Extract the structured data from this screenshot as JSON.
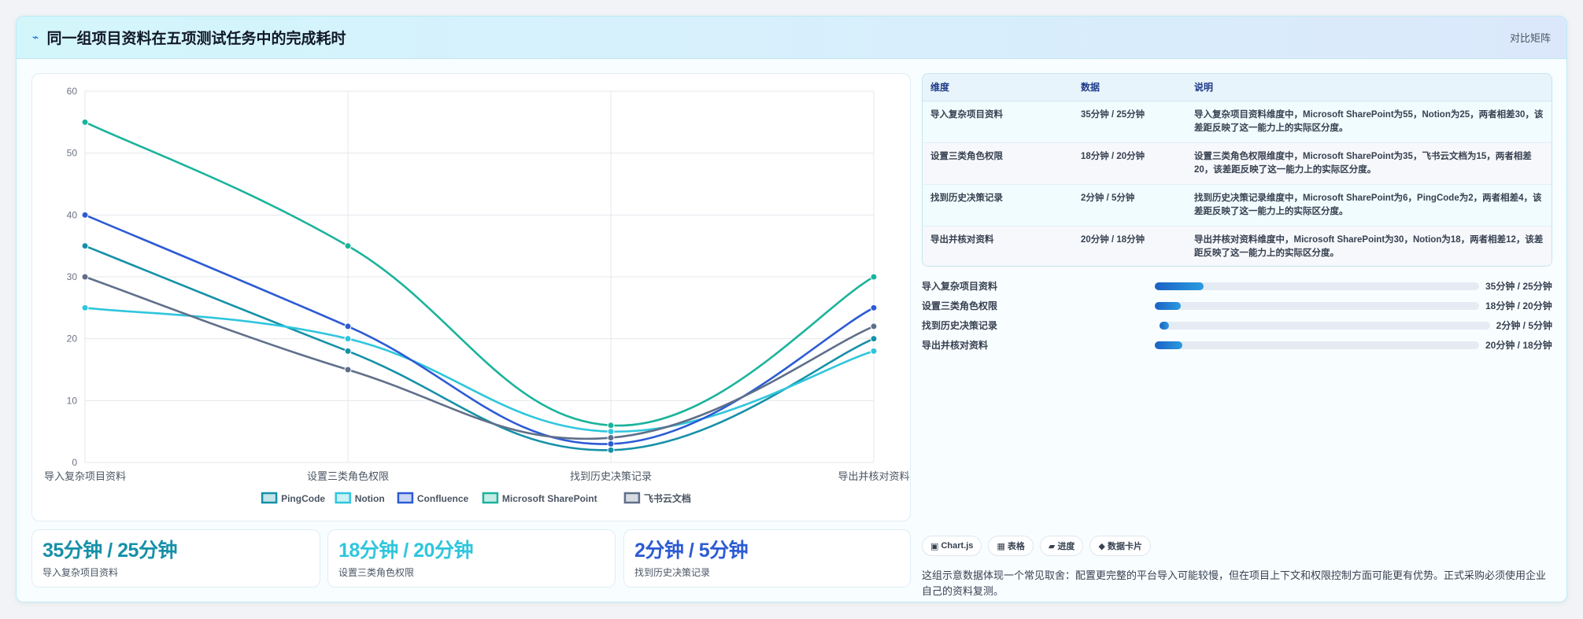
{
  "header": {
    "title": "同一组项目资料在五项测试任务中的完成耗时",
    "right_label": "对比矩阵"
  },
  "chart_data": {
    "type": "line",
    "categories": [
      "导入复杂项目资料",
      "设置三类角色权限",
      "找到历史决策记录",
      "导出并核对资料"
    ],
    "ylim": [
      0,
      60
    ],
    "yticks": [
      0,
      10,
      20,
      30,
      40,
      50,
      60
    ],
    "legend_position": "bottom",
    "grid": true,
    "series": [
      {
        "name": "PingCode",
        "color": "#1690a8",
        "values": [
          35,
          18,
          2,
          20
        ]
      },
      {
        "name": "Notion",
        "color": "#2fc6dd",
        "values": [
          25,
          20,
          5,
          18
        ]
      },
      {
        "name": "Confluence",
        "color": "#2d5bd4",
        "values": [
          40,
          22,
          3,
          25
        ]
      },
      {
        "name": "Microsoft SharePoint",
        "color": "#1bb39c",
        "values": [
          55,
          35,
          6,
          30
        ]
      },
      {
        "name": "飞书云文档",
        "color": "#5f6f8a",
        "values": [
          30,
          15,
          4,
          22
        ]
      }
    ]
  },
  "stats": [
    {
      "value": "35分钟 / 25分钟",
      "label": "导入复杂项目资料",
      "color": "#1690a8"
    },
    {
      "value": "18分钟 / 20分钟",
      "label": "设置三类角色权限",
      "color": "#2fc6dd"
    },
    {
      "value": "2分钟 / 5分钟",
      "label": "找到历史决策记录",
      "color": "#2d5bd4"
    }
  ],
  "table": {
    "headers": [
      "维度",
      "数据",
      "说明"
    ],
    "rows": [
      {
        "dim": "导入复杂项目资料",
        "data": "35分钟 / 25分钟",
        "desc": "导入复杂项目资料维度中，Microsoft SharePoint为55，Notion为25，两者相差30，该差距反映了这一能力上的实际区分度。"
      },
      {
        "dim": "设置三类角色权限",
        "data": "18分钟 / 20分钟",
        "desc": "设置三类角色权限维度中，Microsoft SharePoint为35，飞书云文档为15，两者相差20，该差距反映了这一能力上的实际区分度。"
      },
      {
        "dim": "找到历史决策记录",
        "data": "2分钟 / 5分钟",
        "desc": "找到历史决策记录维度中，Microsoft SharePoint为6，PingCode为2，两者相差4，该差距反映了这一能力上的实际区分度。"
      },
      {
        "dim": "导出并核对资料",
        "data": "20分钟 / 18分钟",
        "desc": "导出并核对资料维度中，Microsoft SharePoint为30，Notion为18，两者相差12，该差距反映了这一能力上的实际区分度。"
      }
    ]
  },
  "progress": [
    {
      "name": "导入复杂项目资料",
      "text": "35分钟 / 25分钟",
      "fraction": 0.15
    },
    {
      "name": "设置三类角色权限",
      "text": "18分钟 / 20分钟",
      "fraction": 0.08
    },
    {
      "name": "找到历史决策记录",
      "text": "2分钟 / 5分钟",
      "fraction": 0.03
    },
    {
      "name": "导出并核对资料",
      "text": "20分钟 / 18分钟",
      "fraction": 0.085
    }
  ],
  "tags": [
    {
      "icon": "chart-icon",
      "glyph": "▣",
      "label": "Chart.js"
    },
    {
      "icon": "table-icon",
      "glyph": "▦",
      "label": "表格"
    },
    {
      "icon": "progress-icon",
      "glyph": "▰",
      "label": "进度"
    },
    {
      "icon": "card-icon",
      "glyph": "◆",
      "label": "数据卡片"
    }
  ],
  "note": "这组示意数据体现一个常见取舍：配置更完整的平台导入可能较慢，但在项目上下文和权限控制方面可能更有优势。正式采购必须使用企业自己的资料复测。"
}
